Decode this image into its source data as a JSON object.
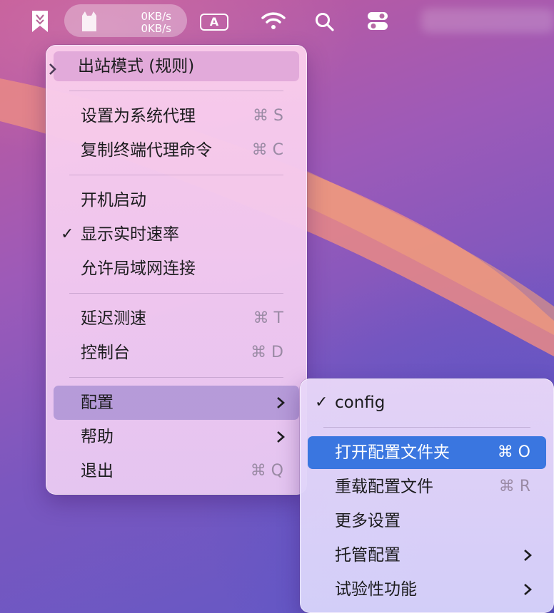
{
  "menubar": {
    "speed_up": "0KB/s",
    "speed_down": "0KB/s",
    "input_source": "A",
    "icons": [
      "app-bookmark-icon",
      "cat-icon",
      "wifi-icon",
      "search-icon",
      "control-center-icon"
    ]
  },
  "main_menu": {
    "outbound_mode": "出站模式 (规则)",
    "set_system_proxy": {
      "label": "设置为系统代理",
      "shortcut": "⌘ S"
    },
    "copy_terminal_cmd": {
      "label": "复制终端代理命令",
      "shortcut": "⌘ C"
    },
    "launch_at_login": {
      "label": "开机启动"
    },
    "show_speed": {
      "label": "显示实时速率",
      "checked": true,
      "check": "✓"
    },
    "allow_lan": {
      "label": "允许局域网连接"
    },
    "latency_test": {
      "label": "延迟测速",
      "shortcut": "⌘ T"
    },
    "dashboard": {
      "label": "控制台",
      "shortcut": "⌘ D"
    },
    "config": {
      "label": "配置"
    },
    "help": {
      "label": "帮助"
    },
    "quit": {
      "label": "退出",
      "shortcut": "⌘ Q"
    }
  },
  "config_submenu": {
    "current": {
      "label": "config",
      "checked": true,
      "check": "✓"
    },
    "open_folder": {
      "label": "打开配置文件夹",
      "shortcut": "⌘ O"
    },
    "reload": {
      "label": "重载配置文件",
      "shortcut": "⌘ R"
    },
    "more_settings": {
      "label": "更多设置"
    },
    "managed_config": {
      "label": "托管配置"
    },
    "experimental": {
      "label": "试验性功能"
    }
  },
  "colors": {
    "highlight": "#3a76e0",
    "shortcut_text": "#9a8aa4"
  }
}
